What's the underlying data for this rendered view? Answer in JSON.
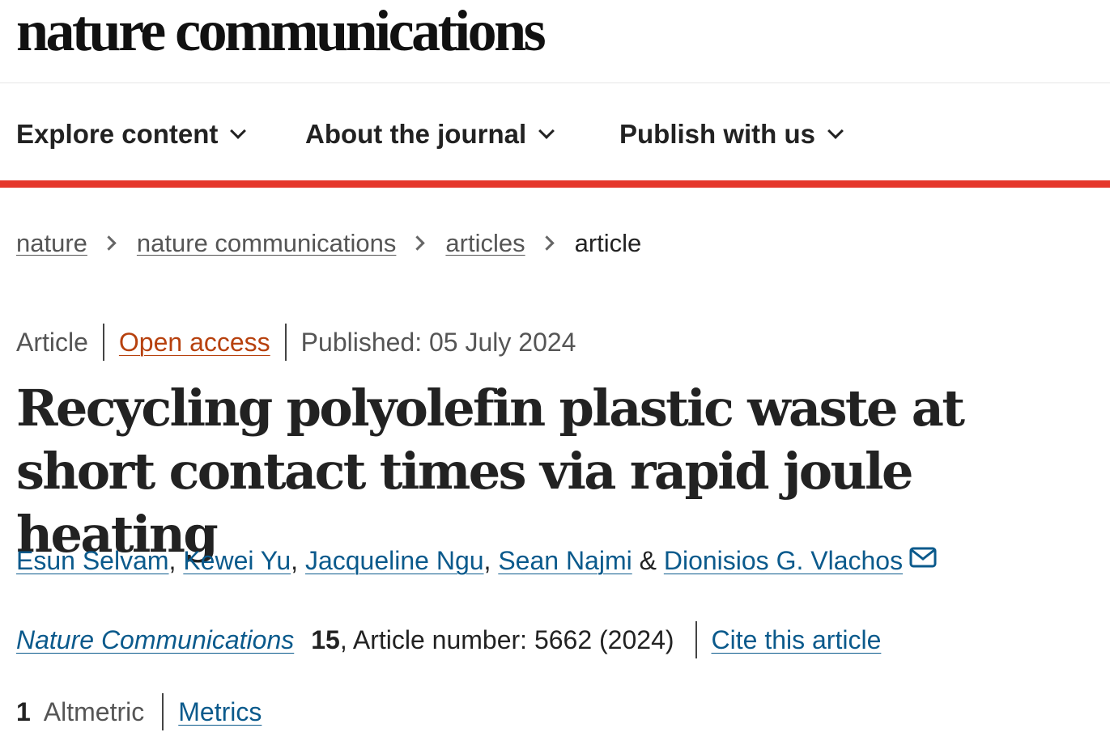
{
  "header": {
    "logo_text": "nature communications"
  },
  "nav": {
    "items": [
      {
        "label": "Explore content"
      },
      {
        "label": "About the journal"
      },
      {
        "label": "Publish with us"
      }
    ],
    "accent_color": "#e5372b"
  },
  "breadcrumb": {
    "items": [
      "nature",
      "nature communications",
      "articles"
    ],
    "current": "article"
  },
  "article": {
    "type": "Article",
    "access": "Open access",
    "published": "Published: 05 July 2024",
    "title": "Recycling polyolefin plastic waste at short contact times via rapid joule heating",
    "authors": [
      {
        "name": "Esun Selvam",
        "sep": ", "
      },
      {
        "name": "Kewei Yu",
        "sep": ", "
      },
      {
        "name": "Jacqueline Ngu",
        "sep": ", "
      },
      {
        "name": "Sean Najmi",
        "sep": " & "
      },
      {
        "name": "Dionisios G. Vlachos",
        "sep": ""
      }
    ],
    "corresponding_icon": "mail-icon",
    "citation": {
      "journal": "Nature Communications",
      "volume": "15",
      "article_number": ", Article number: 5662 (2024)",
      "cite_label": "Cite this article"
    },
    "metrics": {
      "altmetric_count": "1",
      "altmetric_label": "Altmetric",
      "metrics_label": "Metrics"
    }
  },
  "colors": {
    "link": "#0b5a8c",
    "open_access": "#b7410e",
    "text": "#222222"
  }
}
